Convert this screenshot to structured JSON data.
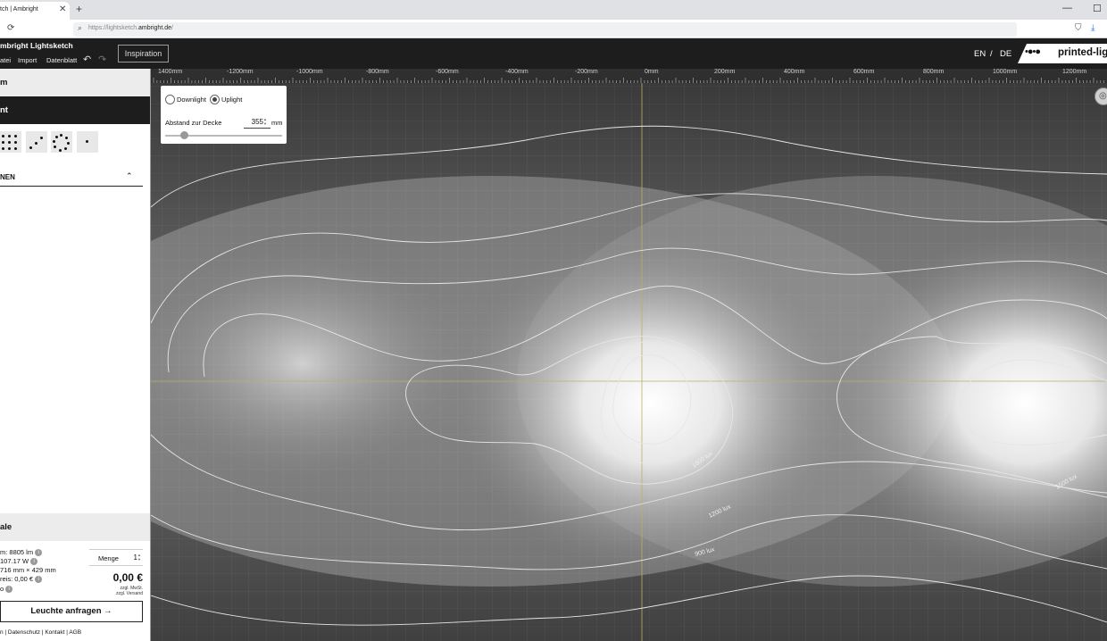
{
  "browser": {
    "tab_title": "tch | Ambright",
    "tab_close": "✕",
    "new_tab": "+",
    "min": "—",
    "max": "☐",
    "url_prefix": "https://lightsketch.",
    "url_host": "ambright.de",
    "url_suffix": "/"
  },
  "app": {
    "title": "mbright Lightsketch",
    "menu": [
      "atei",
      "Import",
      "Datenblatt"
    ],
    "undo": "↶",
    "redo": "↷",
    "inspiration": "Inspiration",
    "lang_en": "EN",
    "lang_sep": "/",
    "lang_de": "DE",
    "brand": "printed-lig",
    "brand_dots": "•●•●"
  },
  "left": {
    "section1": "m",
    "section2": "nt",
    "presets": [
      "grid",
      "arc",
      "circle",
      "single"
    ],
    "collapse_label": "NEN",
    "collapse_icon": "⌃",
    "section3": "ale",
    "stats": [
      "m: 8805 lm",
      "107.17 W",
      "716 mm × 429 mm",
      "reis: 0,00 €",
      "o"
    ],
    "info_icon": "i",
    "qty_label": "Menge",
    "qty_value": "1",
    "price": "0,00 €",
    "price_note1": "zzgl. MwSt.",
    "price_note2": "zzgl. Versand",
    "cta": "Leuchte anfragen →",
    "footer": "n  |  Datenschutz  |  Kontakt  |  AGB"
  },
  "canvas": {
    "ruler_labels": [
      "1400mm",
      "-1200mm",
      "-1000mm",
      "-800mm",
      "-600mm",
      "-400mm",
      "-200mm",
      "0mm",
      "200mm",
      "400mm",
      "600mm",
      "800mm",
      "1000mm",
      "1200mm"
    ],
    "contour_labels": [
      "2100 lux",
      "1800 lux",
      "1500 lux",
      "1200 lux",
      "900 lux"
    ],
    "options": {
      "downlight": "Downlight",
      "uplight": "Uplight",
      "selected": "Uplight",
      "distance_label": "Abstand zur Decke",
      "distance_value": "355",
      "distance_unit": "mm",
      "slider_fraction": 0.16
    },
    "view_icon": "◎"
  },
  "colors": {
    "accent_dark": "#1d1d1d",
    "contour": "#e6e6e6",
    "axis": "#b8b06a"
  }
}
